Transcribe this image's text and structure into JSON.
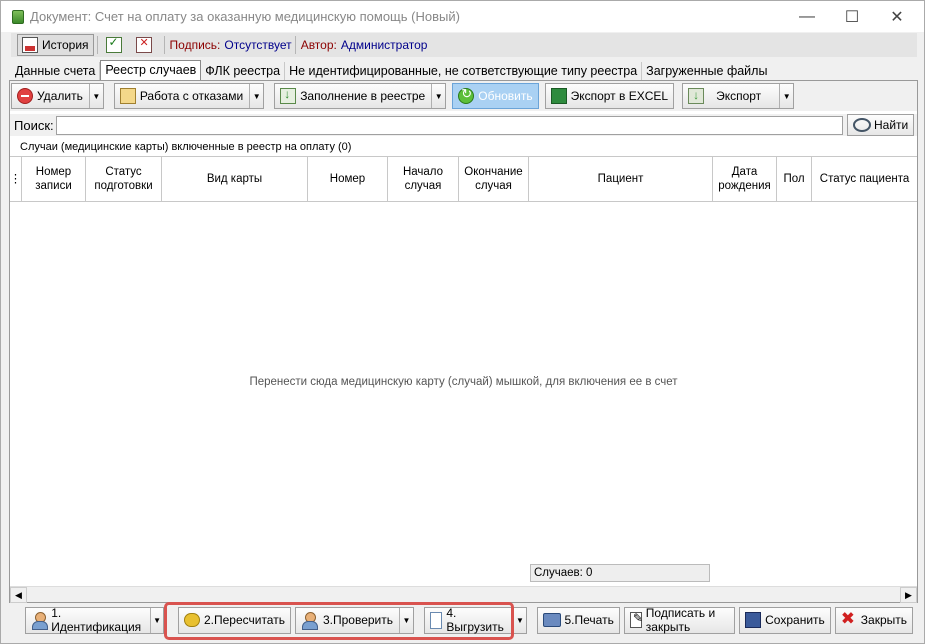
{
  "window": {
    "title": "Документ: Счет на оплату за оказанную медицинскую помощь (Новый)",
    "minimize_glyph": "—",
    "maximize_glyph": "☐",
    "close_glyph": "✕"
  },
  "top_toolbar": {
    "history_label": "История",
    "sign_label": "Подпись:",
    "sign_value": "Отсутствует",
    "author_label": "Автор:",
    "author_value": "Администратор"
  },
  "tabs": [
    {
      "label": "Данные счета",
      "active": false
    },
    {
      "label": "Реестр случаев",
      "active": true
    },
    {
      "label": "ФЛК реестра",
      "active": false
    },
    {
      "label": "Не идентифицированные, не сответствующие типу реестра",
      "active": false
    },
    {
      "label": "Загруженные файлы",
      "active": false
    }
  ],
  "registry_toolbar": {
    "delete_label": "Удалить",
    "rejections_label": "Работа с отказами",
    "fill_label": "Заполнение в реестре",
    "refresh_label": "Обновить",
    "excel_label": "Экспорт в EXCEL",
    "export_label": "Экспорт",
    "dropdown_glyph": "▼"
  },
  "search": {
    "label": "Поиск:",
    "value": "",
    "find_label": "Найти"
  },
  "grid": {
    "caption": "Случаи (медицинские карты) включенные в реестр на оплату (0)",
    "columns": [
      "Номер записи",
      "Статус подготовки",
      "Вид карты",
      "Номер",
      "Начало случая",
      "Окончание случая",
      "Пациент",
      "Дата рождения",
      "Пол",
      "Статус пациента"
    ],
    "empty_message": "Перенести сюда медицинскую карту (случай) мышкой, для включения ее в счет",
    "count_text": "Случаев: 0"
  },
  "bottom_bar": {
    "identify_label": "1. Идентификация",
    "recalc_label": "2.Пересчитать",
    "check_label": "3.Проверить",
    "upload_label": "4. Выгрузить",
    "print_label": "5.Печать",
    "sign_close_label": "Подписать и закрыть",
    "save_label": "Сохранить",
    "close_label": "Закрыть"
  },
  "colors": {
    "highlight": "#d9534f",
    "sign_label": "#8b0000",
    "sign_value": "#00008b",
    "refresh_button": "#aad1f3"
  }
}
